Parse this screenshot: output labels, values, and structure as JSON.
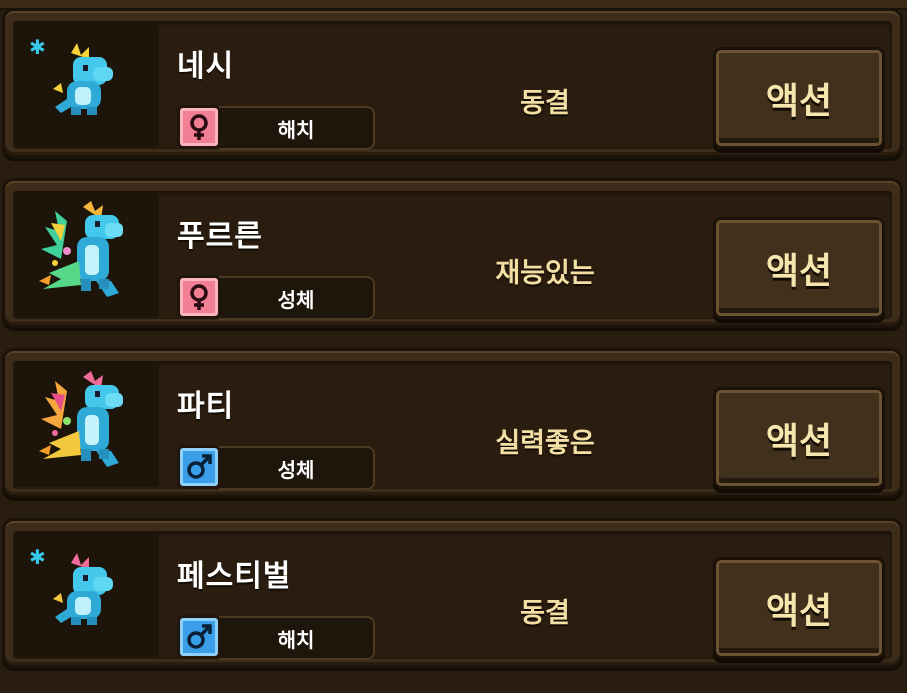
{
  "action_label": "액션",
  "dragons": [
    {
      "name": "네시",
      "gender": "female",
      "stage": "해치",
      "status": "동결",
      "frozen": true,
      "palette": "blue"
    },
    {
      "name": "푸르른",
      "gender": "female",
      "stage": "성체",
      "status": "재능있는",
      "frozen": false,
      "palette": "green"
    },
    {
      "name": "파티",
      "gender": "male",
      "stage": "성체",
      "status": "실력좋은",
      "frozen": false,
      "palette": "party"
    },
    {
      "name": "페스티벌",
      "gender": "male",
      "stage": "해치",
      "status": "동결",
      "frozen": true,
      "palette": "festival"
    }
  ],
  "colors": {
    "female": "#f27f94",
    "male": "#3a9ee8",
    "status_text": "#f3dfa4",
    "frozen_sparkle": "#35c8e8"
  },
  "icons": {
    "female": "female-symbol-icon",
    "male": "male-symbol-icon",
    "frozen": "snowflake-sparkle-icon"
  }
}
